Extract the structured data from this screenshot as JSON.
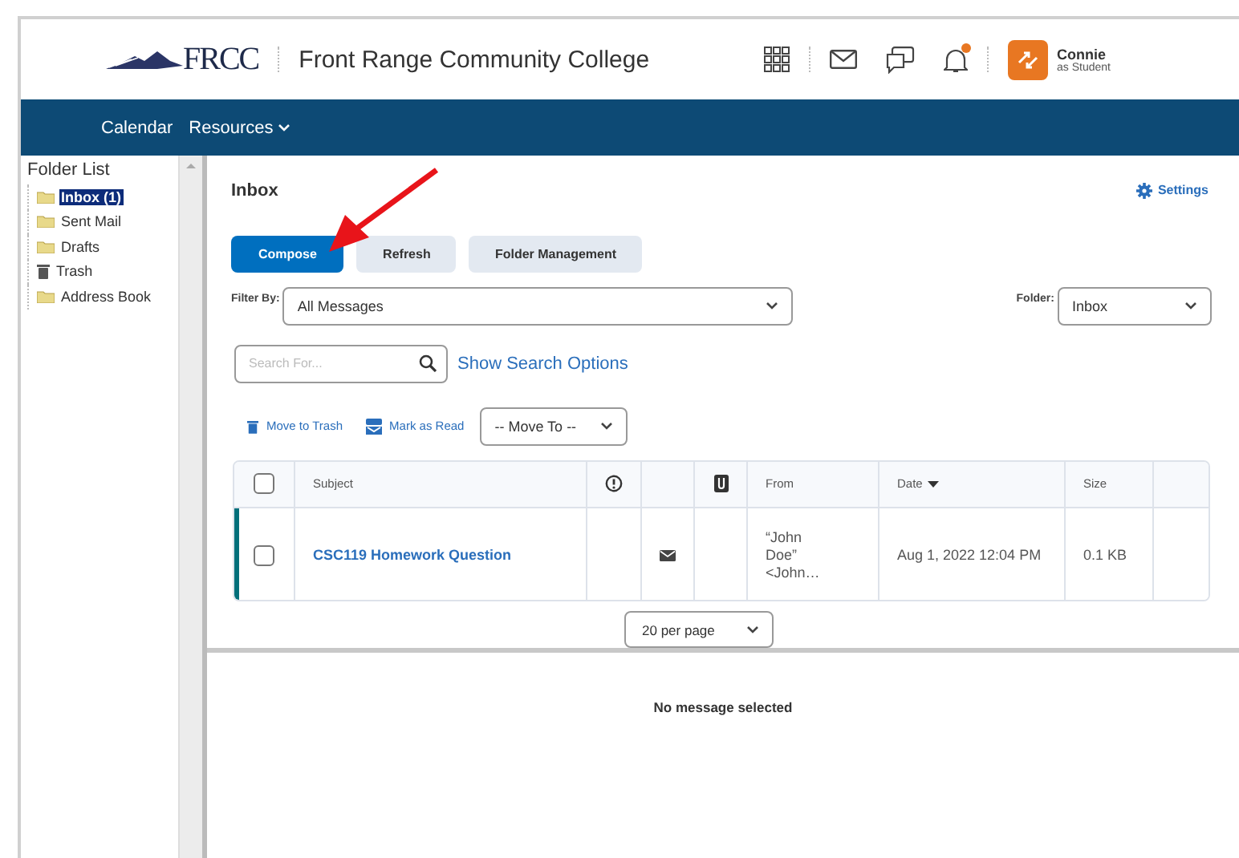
{
  "header": {
    "logo_text": "FRCC",
    "college_name": "Front Range Community College",
    "notifications_badge": true,
    "user": {
      "name": "Connie",
      "role": "as Student"
    }
  },
  "nav": [
    {
      "label": "Calendar",
      "has_menu": false
    },
    {
      "label": "Resources",
      "has_menu": true
    }
  ],
  "folder_list": {
    "title": "Folder List",
    "items": [
      {
        "label": "Inbox (1)",
        "kind": "folder",
        "selected": true
      },
      {
        "label": "Sent Mail",
        "kind": "folder",
        "selected": false
      },
      {
        "label": "Drafts",
        "kind": "folder",
        "selected": false
      },
      {
        "label": "Trash",
        "kind": "trash",
        "selected": false
      },
      {
        "label": "Address Book",
        "kind": "folder",
        "selected": false
      }
    ]
  },
  "inbox": {
    "title": "Inbox",
    "settings": "Settings",
    "buttons": [
      {
        "label": "Compose",
        "primary": true
      },
      {
        "label": "Refresh",
        "primary": false
      },
      {
        "label": "Folder Management",
        "primary": false
      }
    ],
    "filter": {
      "label": "Filter By:",
      "value": "All Messages"
    },
    "folder": {
      "label": "Folder:",
      "value": "Inbox"
    },
    "search": {
      "placeholder": "Search For...",
      "options_link": "Show Search Options"
    },
    "actions": {
      "move_to_trash": "Move to Trash",
      "mark_as_read": "Mark as Read",
      "move_to": "-- Move To --"
    },
    "table": {
      "select_all_checked": false,
      "headers": {
        "subject": "Subject",
        "from": "From",
        "date": "Date",
        "size": "Size"
      },
      "rows": [
        {
          "checked": false,
          "unread": true,
          "subject": "CSC119 Homework Question",
          "from": "“John Doe” <John…",
          "date": "Aug 1, 2022 12:04 PM",
          "size": "0.1 KB"
        }
      ]
    },
    "per_page": "20 per page"
  },
  "preview": {
    "message": "No message selected"
  }
}
